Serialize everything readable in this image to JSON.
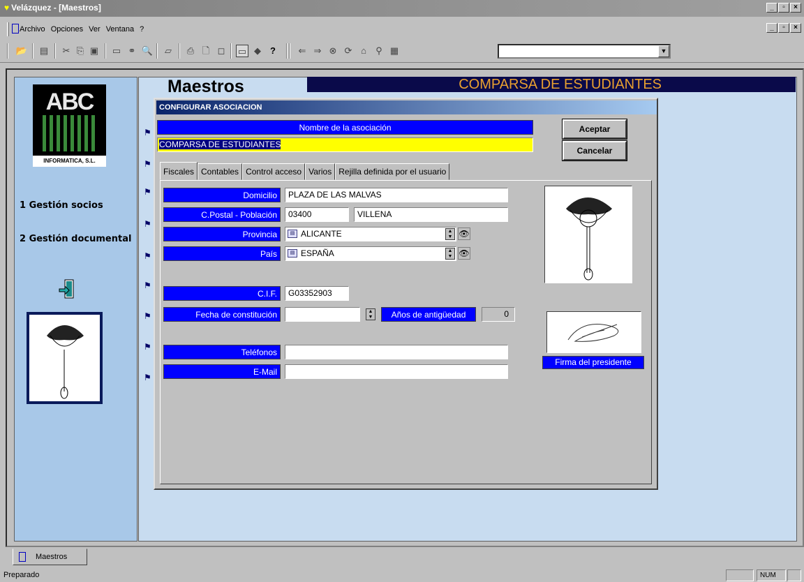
{
  "window": {
    "title": "Velázquez - [Maestros]"
  },
  "menu": {
    "items": [
      "Archivo",
      "Opciones",
      "Ver",
      "Ventana",
      "?"
    ]
  },
  "toolbar": {
    "icons": [
      "open-icon",
      "edit-icon",
      "cut-icon",
      "copy-icon",
      "paste-icon",
      "window-icon",
      "binoculars-icon",
      "find-icon",
      "scanner-icon",
      "print-icon",
      "print-preview-icon",
      "save-icon",
      "monitor-icon",
      "diamond-icon",
      "help-icon",
      "back-icon",
      "forward-icon",
      "stop-icon",
      "refresh-icon",
      "home-icon",
      "search-web-icon",
      "bookmark-icon"
    ],
    "combo_value": ""
  },
  "sidebar": {
    "logo_company": "INFORMATICA, S.L.",
    "logo_text": "ABC",
    "items": [
      {
        "label": "1 Gestión socios"
      },
      {
        "label": "2 Gestión documental"
      }
    ]
  },
  "header": {
    "title": "Maestros",
    "banner": "COMPARSA DE ESTUDIANTES"
  },
  "dialog": {
    "title": "CONFIGURAR ASOCIACION",
    "name_label": "Nombre de la asociación",
    "name_value": "COMPARSA DE ESTUDIANTES",
    "accept_label": "Aceptar",
    "cancel_label": "Cancelar",
    "tabs": [
      {
        "label": "Fiscales",
        "active": true
      },
      {
        "label": "Contables",
        "active": false
      },
      {
        "label": "Control acceso",
        "active": false
      },
      {
        "label": "Varios",
        "active": false
      },
      {
        "label": "Rejilla definida por el usuario",
        "active": false
      }
    ],
    "fields": {
      "domicilio": {
        "label": "Domicilio",
        "value": "PLAZA DE LAS MALVAS"
      },
      "cp": {
        "label": "C.Postal - Población",
        "value": "03400",
        "poblacion": "VILLENA"
      },
      "provincia": {
        "label": "Provincia",
        "value": "ALICANTE"
      },
      "pais": {
        "label": "País",
        "value": "ESPAÑA"
      },
      "cif": {
        "label": "C.I.F.",
        "value": "G03352903"
      },
      "fecha": {
        "label": "Fecha de constitución",
        "value": ""
      },
      "antiguedad": {
        "label": "Años de antigüedad",
        "value": "0"
      },
      "telefonos": {
        "label": "Teléfonos",
        "value": ""
      },
      "email": {
        "label": "E-Mail",
        "value": ""
      }
    },
    "signature_label": "Firma del presidente"
  },
  "taskbar": {
    "tab_label": "Maestros"
  },
  "status": {
    "message": "Preparado",
    "num": "NUM"
  }
}
